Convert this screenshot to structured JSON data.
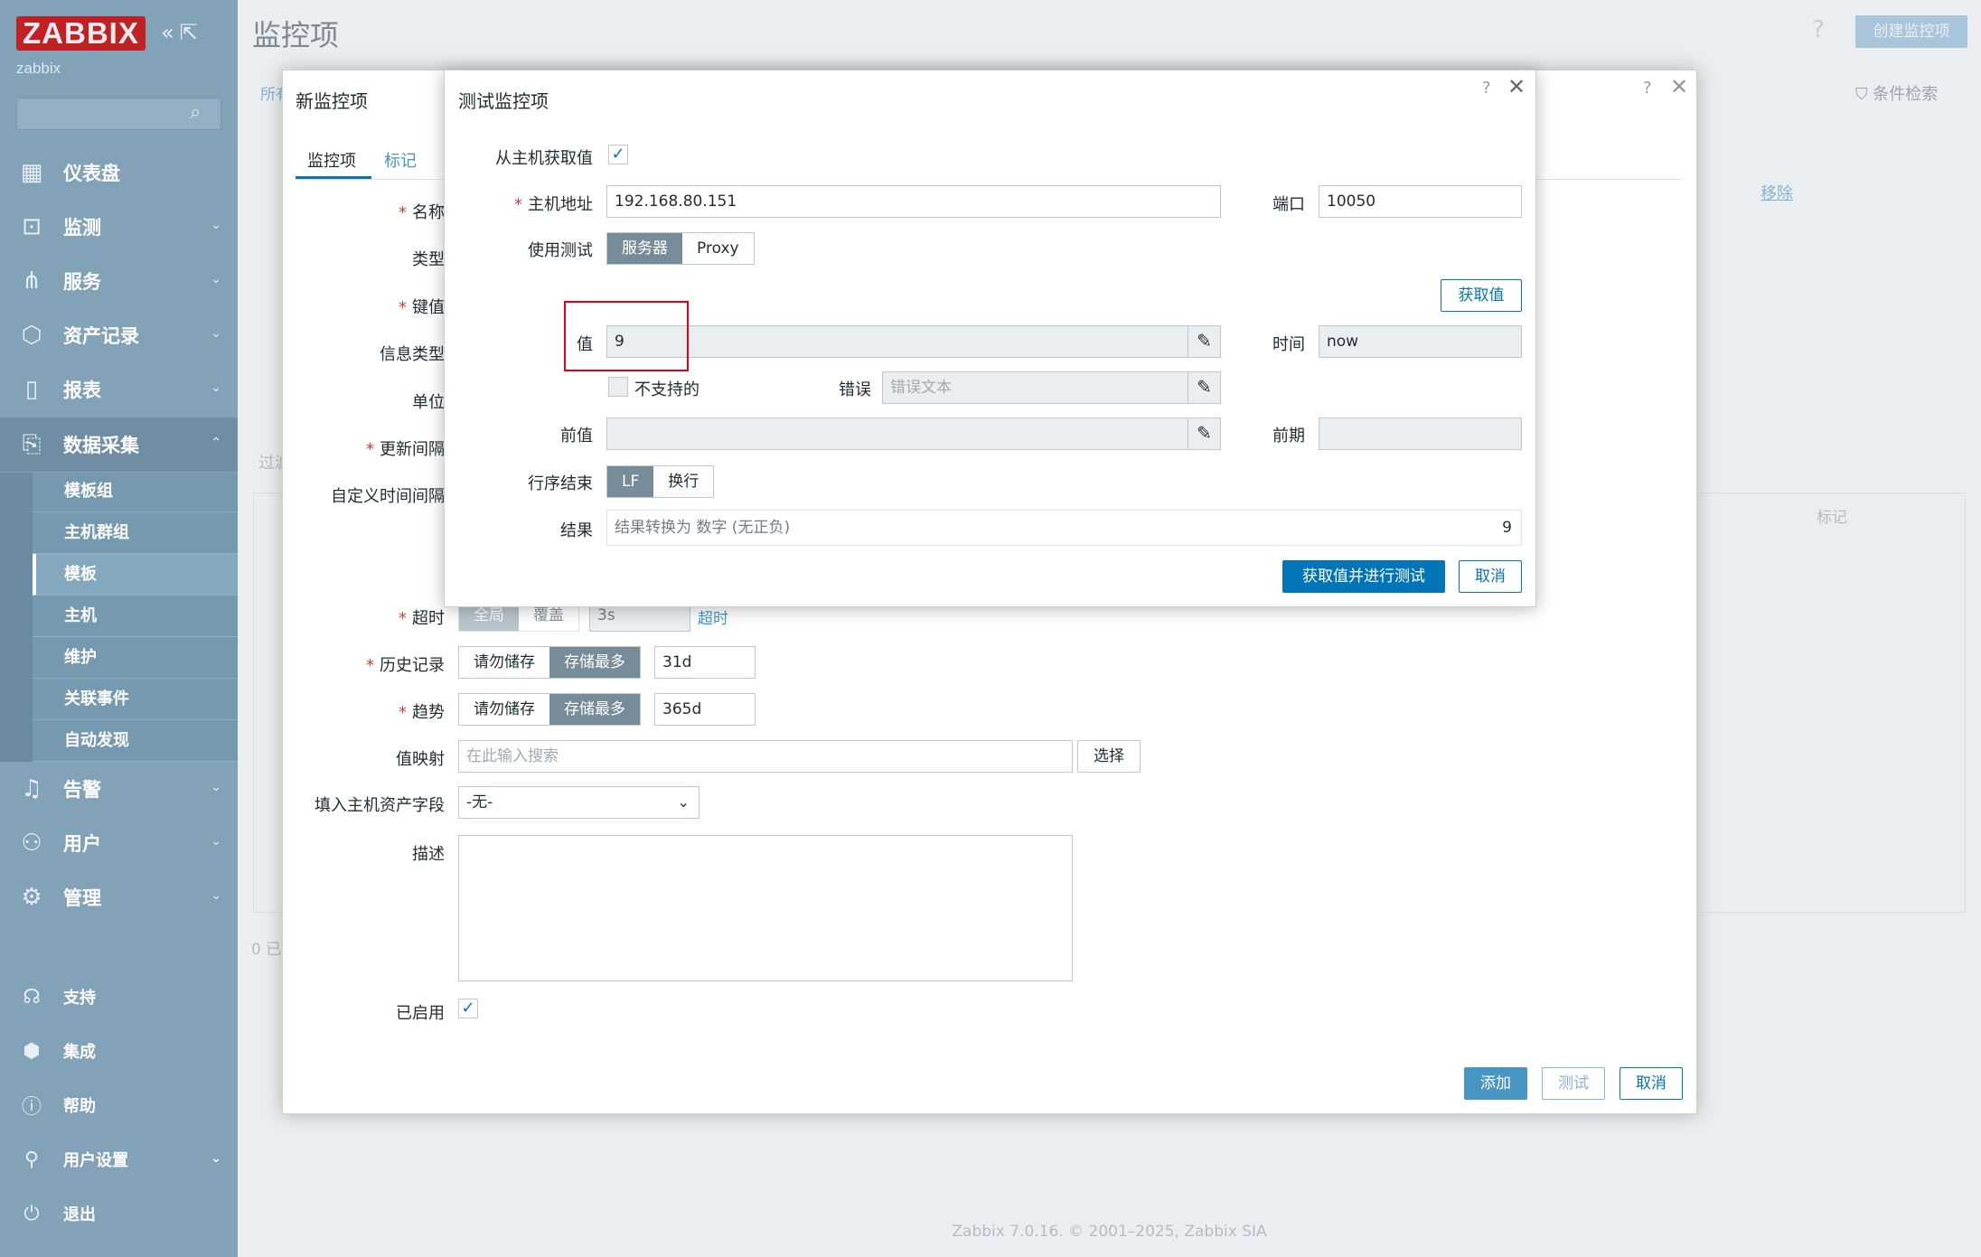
{
  "sidebar": {
    "logo": "ZABBIX",
    "host": "zabbix",
    "search_placeholder": "",
    "menu": [
      {
        "label": "仪表盘",
        "icon": "dashboard-icon"
      },
      {
        "label": "监测",
        "icon": "monitoring-icon"
      },
      {
        "label": "服务",
        "icon": "services-icon"
      },
      {
        "label": "资产记录",
        "icon": "inventory-icon"
      },
      {
        "label": "报表",
        "icon": "reports-icon"
      },
      {
        "label": "数据采集",
        "icon": "data-collection-icon"
      }
    ],
    "submenu": [
      "模板组",
      "主机群组",
      "模板",
      "主机",
      "维护",
      "关联事件",
      "自动发现"
    ],
    "menu2": [
      {
        "label": "告警",
        "icon": "alerts-icon"
      },
      {
        "label": "用户",
        "icon": "users-icon"
      },
      {
        "label": "管理",
        "icon": "administration-icon"
      }
    ],
    "footer": [
      {
        "label": "支持",
        "icon": "support-icon"
      },
      {
        "label": "集成",
        "icon": "integrations-icon"
      },
      {
        "label": "帮助",
        "icon": "help-icon"
      },
      {
        "label": "用户设置",
        "icon": "user-settings-icon"
      },
      {
        "label": "退出",
        "icon": "signout-icon"
      }
    ]
  },
  "header": {
    "title": "监控项",
    "create_button": "创建监控项",
    "filter_label": "条件检索",
    "crumb": "所有",
    "remove_link": "移除",
    "table_tag_col": "标记",
    "filter_partial": "过滤",
    "count_partial": "0 已"
  },
  "item_dialog": {
    "title": "新监控项",
    "tabs": [
      "监控项",
      "标记"
    ],
    "labels": {
      "name": "名称",
      "type": "类型",
      "key": "键值",
      "info_type": "信息类型",
      "units": "单位",
      "interval": "更新间隔",
      "custom_intervals": "自定义时间间隔",
      "timeout": "超时",
      "history": "历史记录",
      "trends": "趋势",
      "valuemap": "值映射",
      "inventory": "填入主机资产字段",
      "description": "描述",
      "enabled": "已启用"
    },
    "timeout_options": [
      "全局",
      "覆盖"
    ],
    "timeout_value": "3s",
    "timeout_link": "超时",
    "history_options": [
      "请勿储存",
      "存储最多"
    ],
    "history_value": "31d",
    "trends_options": [
      "请勿储存",
      "存储最多"
    ],
    "trends_value": "365d",
    "valuemap_placeholder": "在此输入搜索",
    "valuemap_select": "选择",
    "inventory_value": "-无-",
    "buttons": {
      "add": "添加",
      "test": "测试",
      "cancel": "取消"
    }
  },
  "test_dialog": {
    "title": "测试监控项",
    "get_from_host_label": "从主机获取值",
    "host_address_label": "主机地址",
    "host_address_value": "192.168.80.151",
    "port_label": "端口",
    "port_value": "10050",
    "test_with_label": "使用测试",
    "test_with_options": [
      "服务器",
      "Proxy"
    ],
    "get_value_button": "获取值",
    "value_label": "值",
    "value": "9",
    "time_label": "时间",
    "time_value": "now",
    "not_supported_label": "不支持的",
    "error_label": "错误",
    "error_placeholder": "错误文本",
    "prev_value_label": "前值",
    "prev_time_label": "前期",
    "eol_label": "行序结束",
    "eol_options": [
      "LF",
      "换行"
    ],
    "result_label": "结果",
    "result_text": "结果转换为 数字 (无正负)",
    "result_value": "9",
    "submit_button": "获取值并进行测试",
    "cancel_button": "取消"
  },
  "footer_text": "Zabbix 7.0.16. © 2001–2025, Zabbix SIA",
  "colors": {
    "sidebar": "#82a2b8",
    "primary": "#0275b8",
    "required": "#e33734",
    "highlight": "#e60012"
  }
}
